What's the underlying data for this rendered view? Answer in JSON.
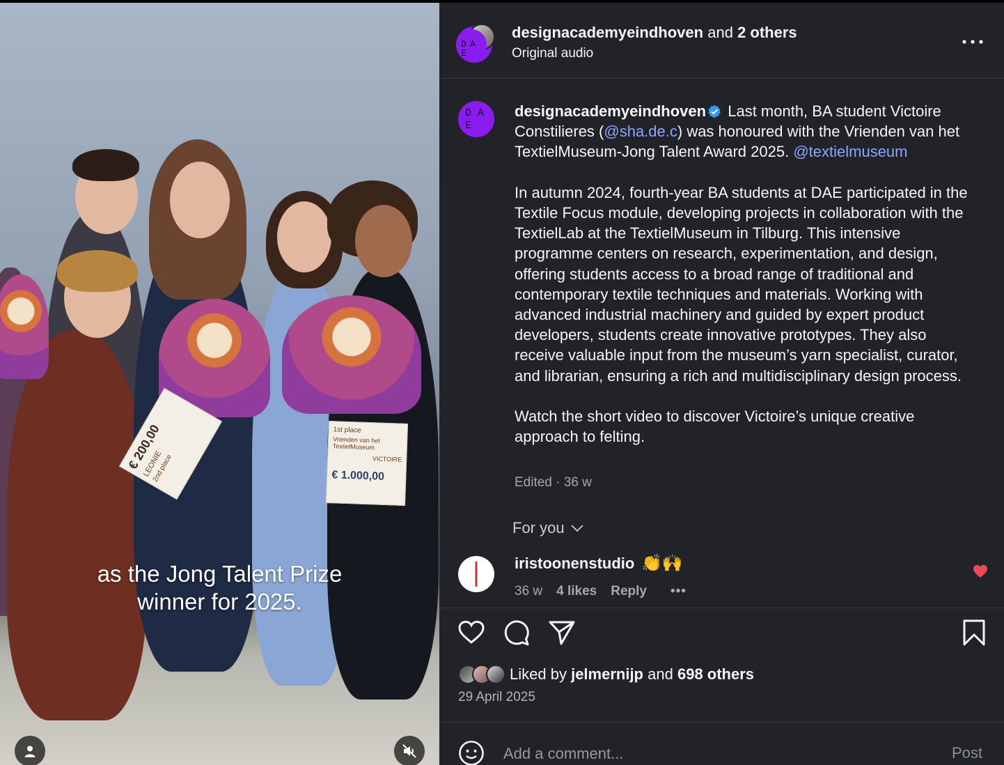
{
  "media": {
    "subtitle_line1": "as the Jong Talent Prize",
    "subtitle_line2": "winner for 2025.",
    "cheque_left_amount": "€ 200,00",
    "cheque_left_name": "LEONIE",
    "cheque_left_place": "2nd place",
    "cheque_right_amount": "€ 1.000,00",
    "cheque_right_name": "VICTOIRE",
    "cheque_right_place": "1st place",
    "cheque_right_org": "Vrienden van het TextielMuseum",
    "user_icon": "user-icon",
    "mute_icon": "muted-speaker-icon"
  },
  "header": {
    "account": "designacademyeindhoven",
    "and_text": "and",
    "others": "2 others",
    "audio": "Original audio",
    "more_icon": "more-horizontal-icon"
  },
  "avatar_letters": [
    "D",
    "A",
    "E"
  ],
  "caption": {
    "username": "designacademyeindhoven",
    "verified_icon": "verified-badge-icon",
    "p1_a": "Last month, BA student Victoire Constilieres (",
    "p1_mention": "@sha.de.c",
    "p1_b": ") was honoured with the Vrienden van het TextielMuseum-Jong Talent Award 2025.",
    "p1_mention2": "@textielmuseum",
    "p2": "In autumn 2024, fourth-year BA students at DAE participated in the Textile Focus module, developing projects in collaboration with the TextielLab at the TextielMuseum in Tilburg. This intensive programme centers on research, experimentation, and design, offering students access to a broad range of traditional and contemporary textile techniques and materials. Working with advanced industrial machinery and guided by expert product developers, students create innovative prototypes. They also receive valuable input from the museum’s yarn specialist, curator, and librarian, ensuring a rich and multidisciplinary design process.",
    "p3": "Watch the short video to discover Victoire’s unique creative approach to felting.",
    "meta": "Edited · 36 w"
  },
  "for_you": "For you",
  "comment": {
    "username": "iristoonenstudio",
    "text": "👏🙌",
    "age": "36 w",
    "likes": "4 likes",
    "reply": "Reply",
    "more": "•••"
  },
  "actions": {
    "like_icon": "heart-icon",
    "comment_icon": "comment-bubble-icon",
    "share_icon": "send-icon",
    "save_icon": "bookmark-icon"
  },
  "likes": {
    "prefix": "Liked by",
    "user": "jelmernijp",
    "and_text": "and",
    "others": "698 others"
  },
  "date": "29 April 2025",
  "comment_box": {
    "placeholder": "Add a comment...",
    "post_label": "Post"
  },
  "colors": {
    "panel_bg": "#212328",
    "avatar_purple": "#8a1cf0",
    "mention": "#8ea4ff",
    "heart_red": "#ed4956"
  }
}
